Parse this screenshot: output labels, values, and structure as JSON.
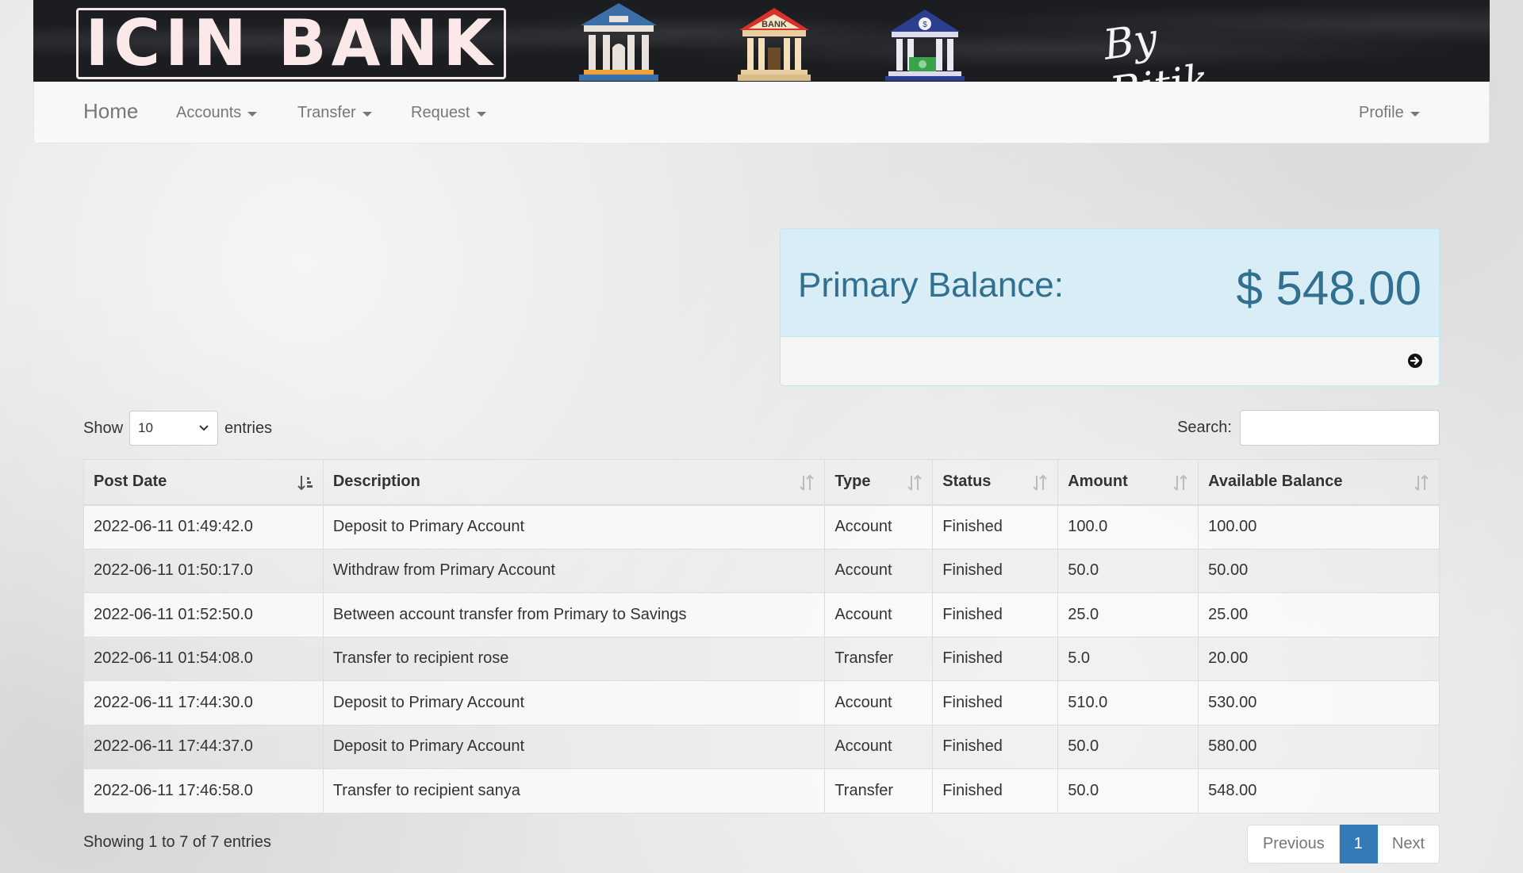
{
  "banner": {
    "logo_text": "ICIN BANK",
    "signature": "By Ritik",
    "bank_label": "BANK"
  },
  "navbar": {
    "brand": "Home",
    "items": [
      {
        "label": "Accounts"
      },
      {
        "label": "Transfer"
      },
      {
        "label": "Request"
      }
    ],
    "profile": "Profile"
  },
  "balance": {
    "label": "Primary Balance:",
    "amount": "$ 548.00"
  },
  "table_controls": {
    "show_label": "Show",
    "entries_label": "entries",
    "page_length": "10",
    "search_label": "Search:",
    "search_value": ""
  },
  "table": {
    "columns": [
      "Post Date",
      "Description",
      "Type",
      "Status",
      "Amount",
      "Available Balance"
    ],
    "rows": [
      [
        "2022-06-11 01:49:42.0",
        "Deposit to Primary Account",
        "Account",
        "Finished",
        "100.0",
        "100.00"
      ],
      [
        "2022-06-11 01:50:17.0",
        "Withdraw from Primary Account",
        "Account",
        "Finished",
        "50.0",
        "50.00"
      ],
      [
        "2022-06-11 01:52:50.0",
        "Between account transfer from Primary to Savings",
        "Account",
        "Finished",
        "25.0",
        "25.00"
      ],
      [
        "2022-06-11 01:54:08.0",
        "Transfer to recipient rose",
        "Transfer",
        "Finished",
        "5.0",
        "20.00"
      ],
      [
        "2022-06-11 17:44:30.0",
        "Deposit to Primary Account",
        "Account",
        "Finished",
        "510.0",
        "530.00"
      ],
      [
        "2022-06-11 17:44:37.0",
        "Deposit to Primary Account",
        "Account",
        "Finished",
        "50.0",
        "580.00"
      ],
      [
        "2022-06-11 17:46:58.0",
        "Transfer to recipient sanya",
        "Transfer",
        "Finished",
        "50.0",
        "548.00"
      ]
    ]
  },
  "footer": {
    "info": "Showing 1 to 7 of 7 entries",
    "previous": "Previous",
    "page": "1",
    "next": "Next"
  },
  "colors": {
    "brand_blue": "#337ab7",
    "info_bg": "#d9edf7",
    "info_text": "#31708f"
  }
}
